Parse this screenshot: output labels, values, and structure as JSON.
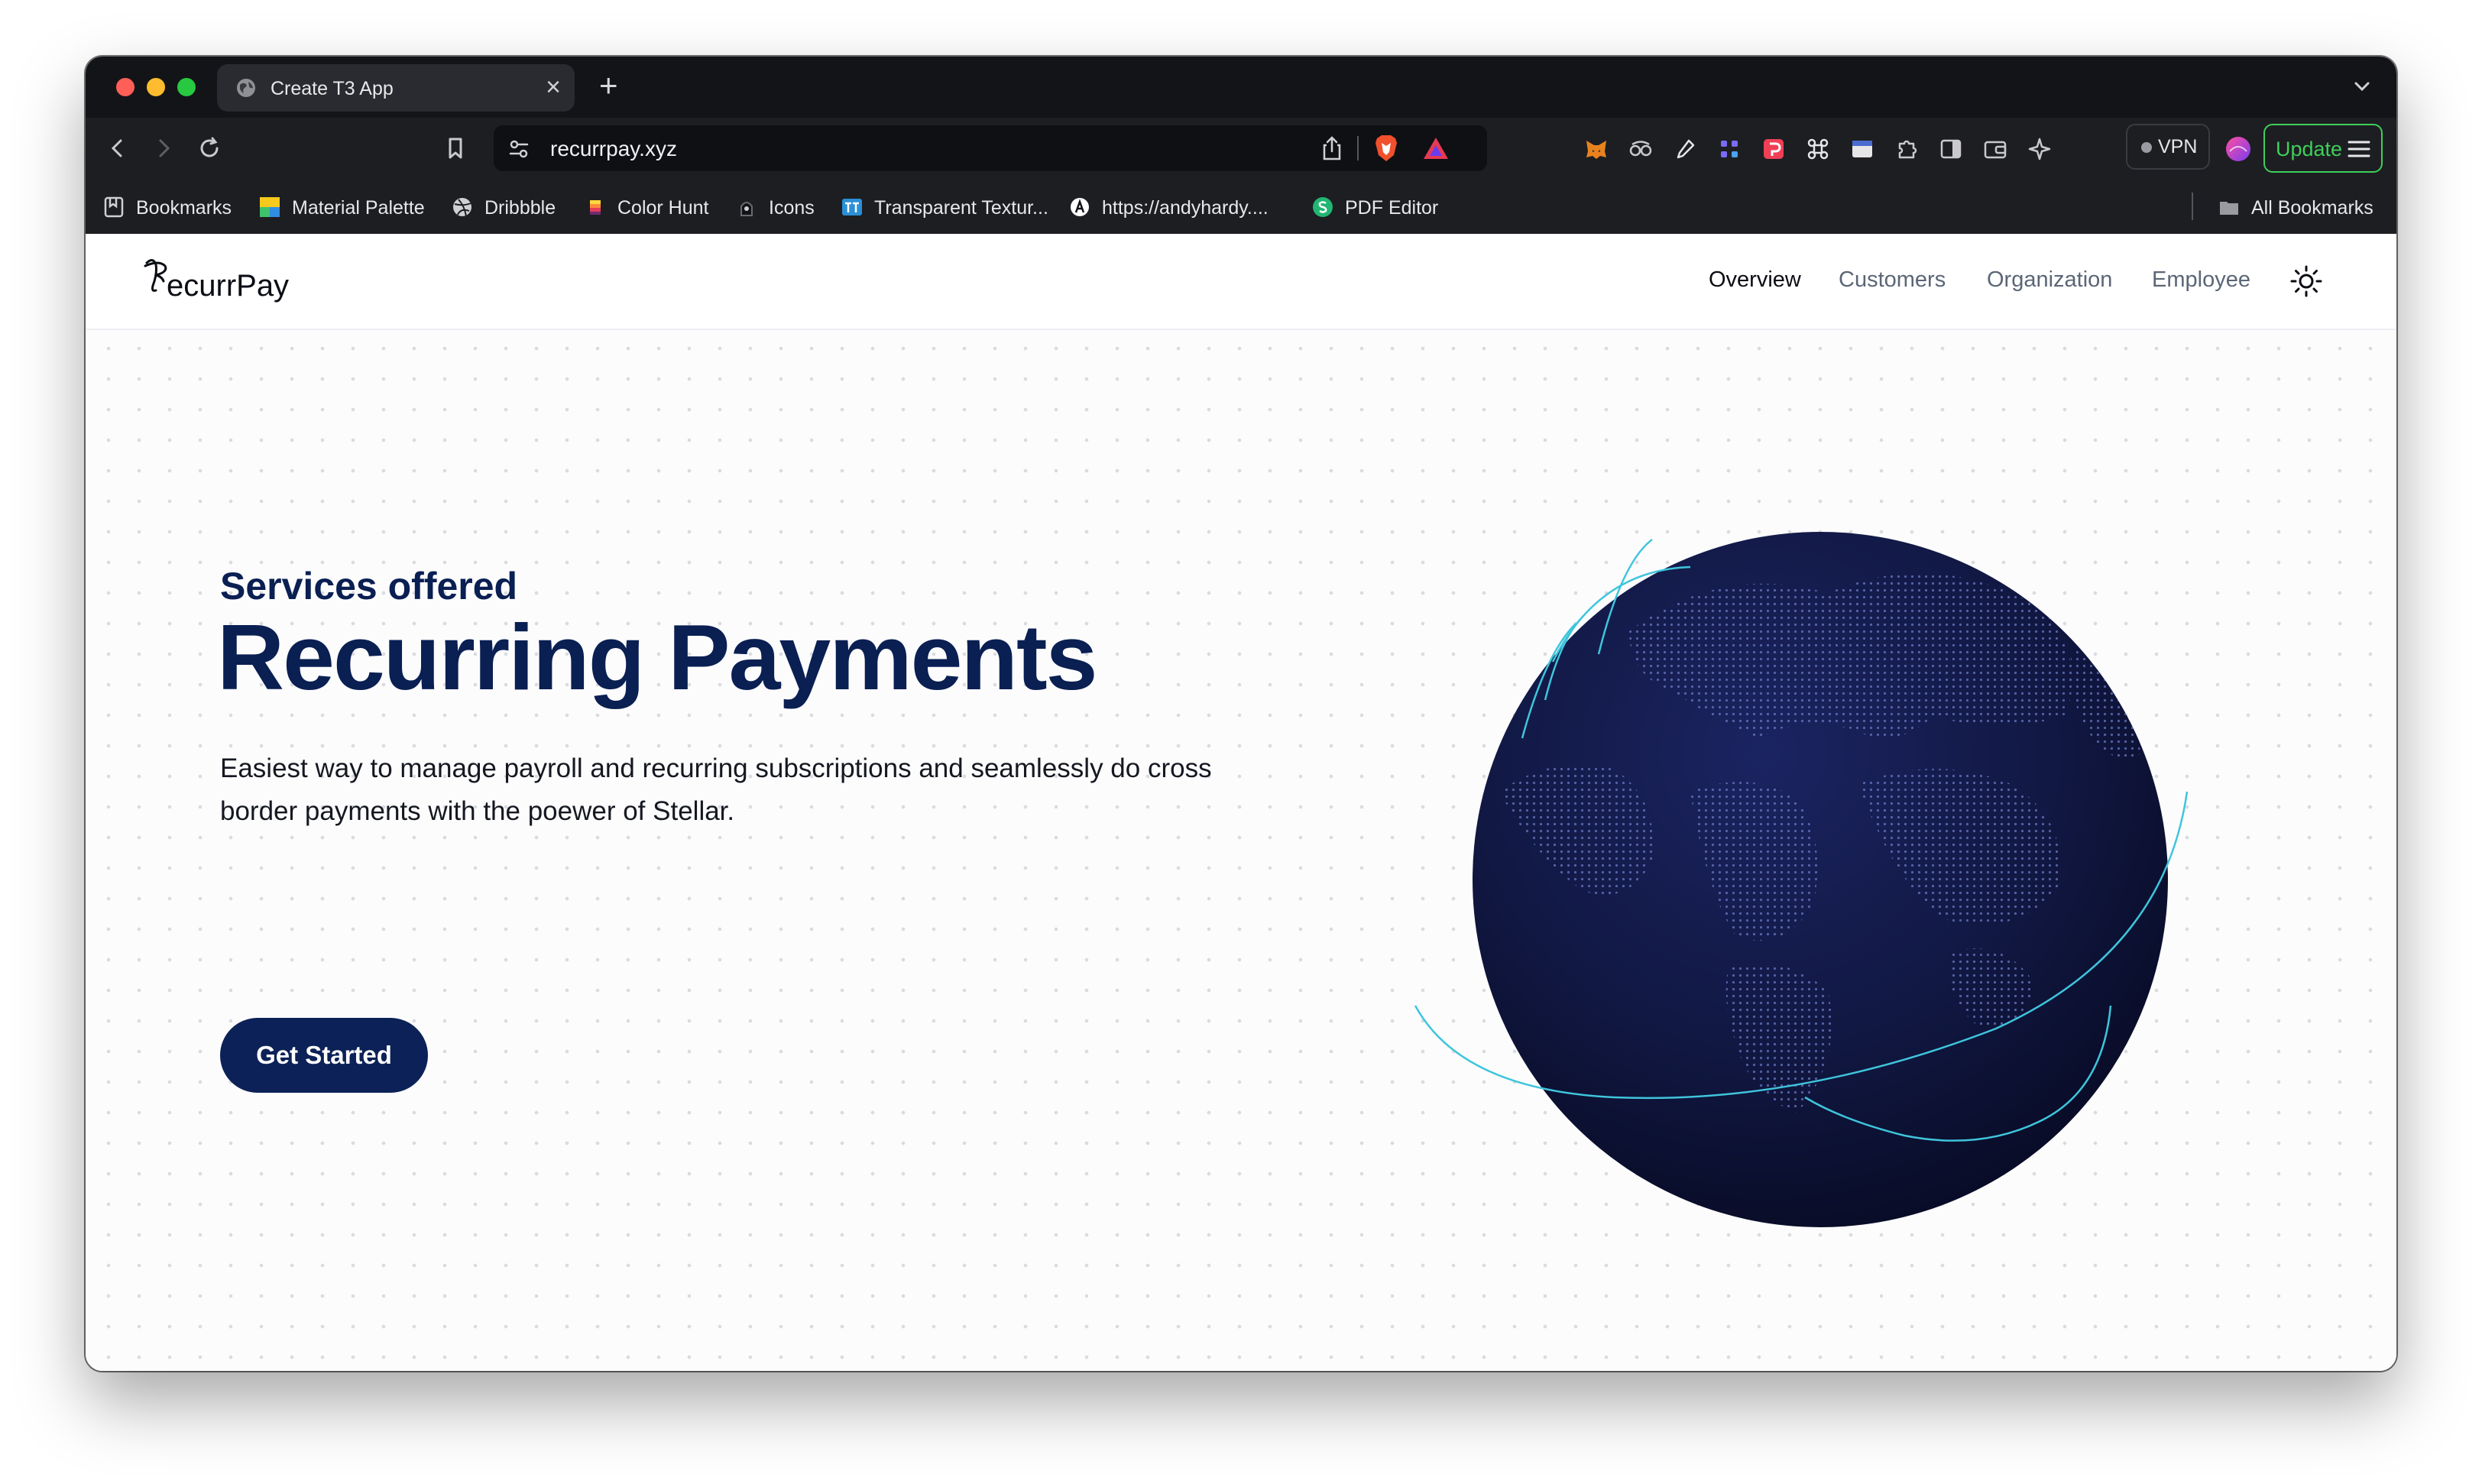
{
  "browser": {
    "tab": {
      "title": "Create T3 App",
      "icon": "globe-icon"
    },
    "new_tab_label": "+",
    "close_tab_label": "×",
    "url": "recurrpay.xyz",
    "vpn_label": "VPN",
    "update_label": "Update",
    "bookmarks": [
      {
        "label": "Bookmarks",
        "icon": "bookmarks-icon"
      },
      {
        "label": "Material Palette",
        "icon": "material-palette-icon"
      },
      {
        "label": "Dribbble",
        "icon": "dribbble-icon"
      },
      {
        "label": "Color Hunt",
        "icon": "color-hunt-icon"
      },
      {
        "label": "Icons",
        "icon": "icons-icon"
      },
      {
        "label": "Transparent Textur...",
        "icon": "transparent-textures-icon"
      },
      {
        "label": "https://andyhardy....",
        "icon": "andyhardy-icon"
      },
      {
        "label": "PDF Editor",
        "icon": "pdf-editor-icon"
      }
    ],
    "all_bookmarks_label": "All Bookmarks",
    "colors": {
      "update_green": "#3ecf5a",
      "chrome_dark": "#1d1e22"
    }
  },
  "site": {
    "logo_text": "ecurrPay",
    "nav": [
      {
        "label": "Overview",
        "active": true
      },
      {
        "label": "Customers",
        "active": false
      },
      {
        "label": "Organization",
        "active": false
      },
      {
        "label": "Employee",
        "active": false
      }
    ],
    "theme_toggle_icon": "sun-icon"
  },
  "hero": {
    "eyebrow": "Services offered",
    "title": "Recurring Payments",
    "description": "Easiest way to manage payroll and recurring subscriptions and seamlessly do cross border payments with the poewer of Stellar.",
    "cta_label": "Get Started",
    "colors": {
      "primary_navy": "#0a1f52",
      "globe_dark": "#0b1033",
      "arc_cyan": "#3fc5dc"
    }
  }
}
